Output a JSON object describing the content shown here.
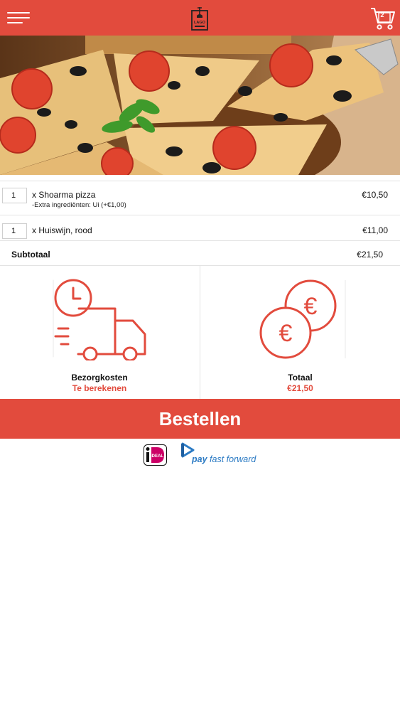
{
  "header": {
    "menu_icon": "hamburger-menu-icon",
    "logo_text": "LAGO",
    "cart_icon": "shopping-cart-icon",
    "cart_count": "2",
    "accent_color": "#e24b3d"
  },
  "hero": {
    "image": "pizza-photo"
  },
  "order": {
    "items": [
      {
        "qty": "1",
        "name": "x Shoarma pizza",
        "extra": "-Extra ingrediënten: Ui (+€1,00)",
        "price": "€10,50"
      },
      {
        "qty": "1",
        "name": "x Huiswijn, rood",
        "extra": "",
        "price": "€11,00"
      }
    ],
    "subtotal_label": "Subtotaal",
    "subtotal_value": "€21,50"
  },
  "summary": {
    "delivery": {
      "icon": "delivery-truck-clock-icon",
      "title": "Bezorgkosten",
      "value": "Te berekenen"
    },
    "total": {
      "icon": "euro-coins-icon",
      "title": "Totaal",
      "value": "€21,50"
    }
  },
  "actions": {
    "order_label": "Bestellen"
  },
  "payments": {
    "ideal_label": "iDEAL",
    "pff_pay": "pay",
    "pff_rest": "fast forward"
  }
}
